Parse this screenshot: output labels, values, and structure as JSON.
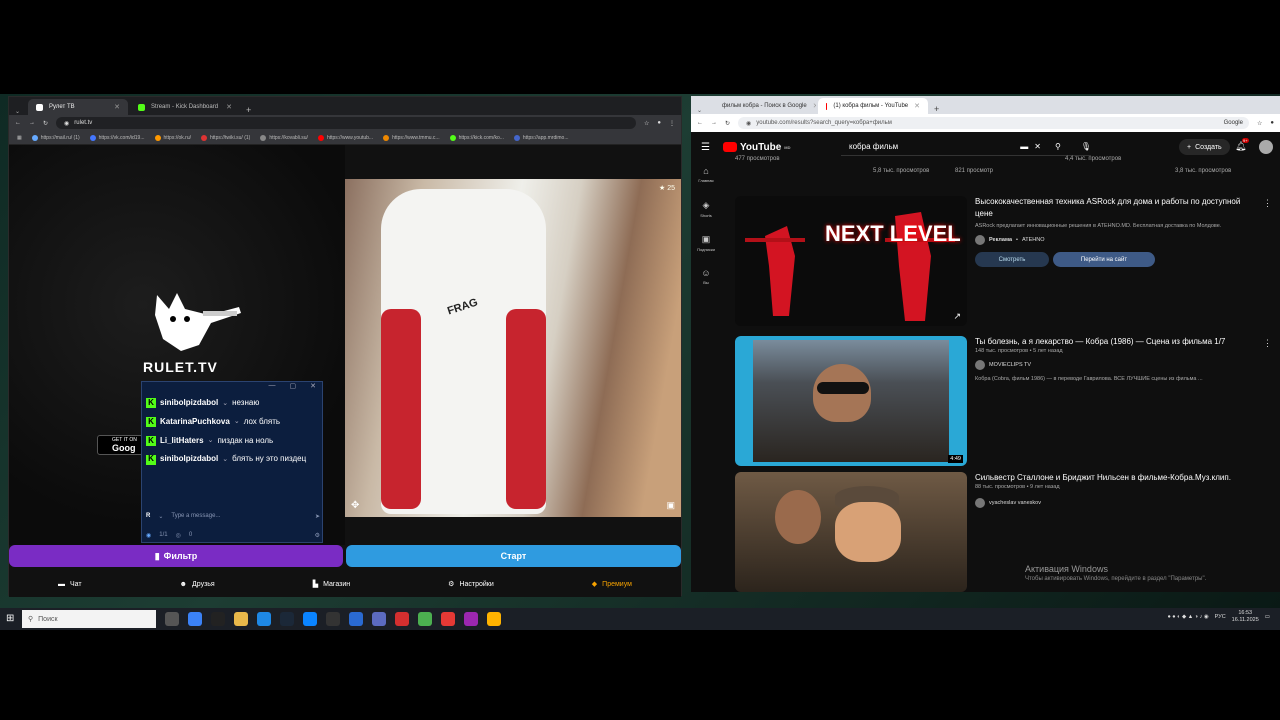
{
  "left_browser": {
    "tabs": [
      {
        "label": "Рулет ТВ",
        "active": true
      },
      {
        "label": "Stream - Kick Dashboard",
        "active": false
      }
    ],
    "url": "rulet.tv",
    "bookmarks": [
      "https://mail.ru/ (1)",
      "https://vk.com/id19...",
      "https://ok.ru/",
      "https://twiki.su/ (1)",
      "https://kovabli.su/",
      "https://www.youtub...",
      "https://www.tmmu.c...",
      "https://kick.com/ko...",
      "https://app.mrdimo..."
    ]
  },
  "rulet": {
    "brand": "RULET.TV",
    "google_play_top": "GET IT ON",
    "google_play_bottom": "Goog",
    "viewer_count": "25",
    "chat": {
      "messages": [
        {
          "user": "sinibolpizdabol",
          "text": "незнаю"
        },
        {
          "user": "KatarinaPuchkova",
          "text": "лох блять"
        },
        {
          "user": "Li_litHaters",
          "text": "пиздак на ноль"
        },
        {
          "user": "sinibolpizdabol",
          "text": "блять ну это пиздец"
        }
      ],
      "input_placeholder": "Type a message...",
      "footer_count": "1/1",
      "footer_views": "0",
      "footer_avatar": "R"
    },
    "filter_button": "Фильтр",
    "start_button": "Старт",
    "nav": [
      {
        "label": "Чат",
        "icon": "chat-icon"
      },
      {
        "label": "Друзья",
        "icon": "friends-icon"
      },
      {
        "label": "Магазин",
        "icon": "shop-icon"
      },
      {
        "label": "Настройки",
        "icon": "settings-icon"
      },
      {
        "label": "Премиум",
        "icon": "premium-icon"
      }
    ]
  },
  "right_browser": {
    "tabs": [
      {
        "label": "фильм кобра - Поиск в Google",
        "active": false
      },
      {
        "label": "(1) кобра фильм - YouTube",
        "active": true
      }
    ],
    "url": "youtube.com/results?search_query=кобра+фильм",
    "google_label": "Google"
  },
  "youtube": {
    "logo": "YouTube",
    "region": "MD",
    "search_query": "кобра фильм",
    "create_label": "Создать",
    "notif_count": "9+",
    "rail": [
      {
        "label": "Главная",
        "icon": "home-icon"
      },
      {
        "label": "Shorts",
        "icon": "shorts-icon"
      },
      {
        "label": "Подписки",
        "icon": "subscriptions-icon"
      },
      {
        "label": "Вы",
        "icon": "you-icon"
      }
    ],
    "prev_row": [
      "477 просмотров",
      "5,8 тыс. просмотров",
      "821 просмотр",
      "4,4 тыс. просмотров",
      "3,8 тыс. просмотров"
    ],
    "results": [
      {
        "title": "Высококачественная техника ASRock для дома и работы по доступной цене",
        "desc": "ASRock предлагает инновационные решения в ATEHNO.MD. Бесплатная доставка по Молдове.",
        "ad_label": "Реклама",
        "channel": "ATEHNO",
        "btn_watch": "Смотреть",
        "btn_site": "Перейти на сайт",
        "thumb_text": "NEXT LEVEL"
      },
      {
        "title": "Ты болезнь, а я лекарство — Кобра (1986) — Сцена из фильма 1/7",
        "meta": "148 тыс. просмотров • 5 лет назад",
        "channel": "MOVIECLIPS TV",
        "desc": "Кобра (Cobra, фильм 1986) — в переводе Гаврилова. ВСЕ ЛУЧШИЕ сцены из фильма ...",
        "duration": "4:49"
      },
      {
        "title": "Сильвестр Сталлоне и Бриджит Нильсен в фильме-Кобра.Муз.клип.",
        "meta": "88 тыс. просмотров • 9 лет назад",
        "channel": "vyacheslav vaneskov"
      }
    ],
    "watermark_title": "Активация Windows",
    "watermark_sub": "Чтобы активировать Windows, перейдите в раздел \"Параметры\"."
  },
  "taskbar": {
    "search_placeholder": "Поиск",
    "lang": "РУС",
    "time": "16:53",
    "date": "16.11.2025"
  },
  "colors": {
    "kick_green": "#53fc18",
    "filter_purple": "#7a2cc4",
    "start_blue": "#2f9be0",
    "yt_red": "#ff0000",
    "premium": "#f6a200"
  }
}
